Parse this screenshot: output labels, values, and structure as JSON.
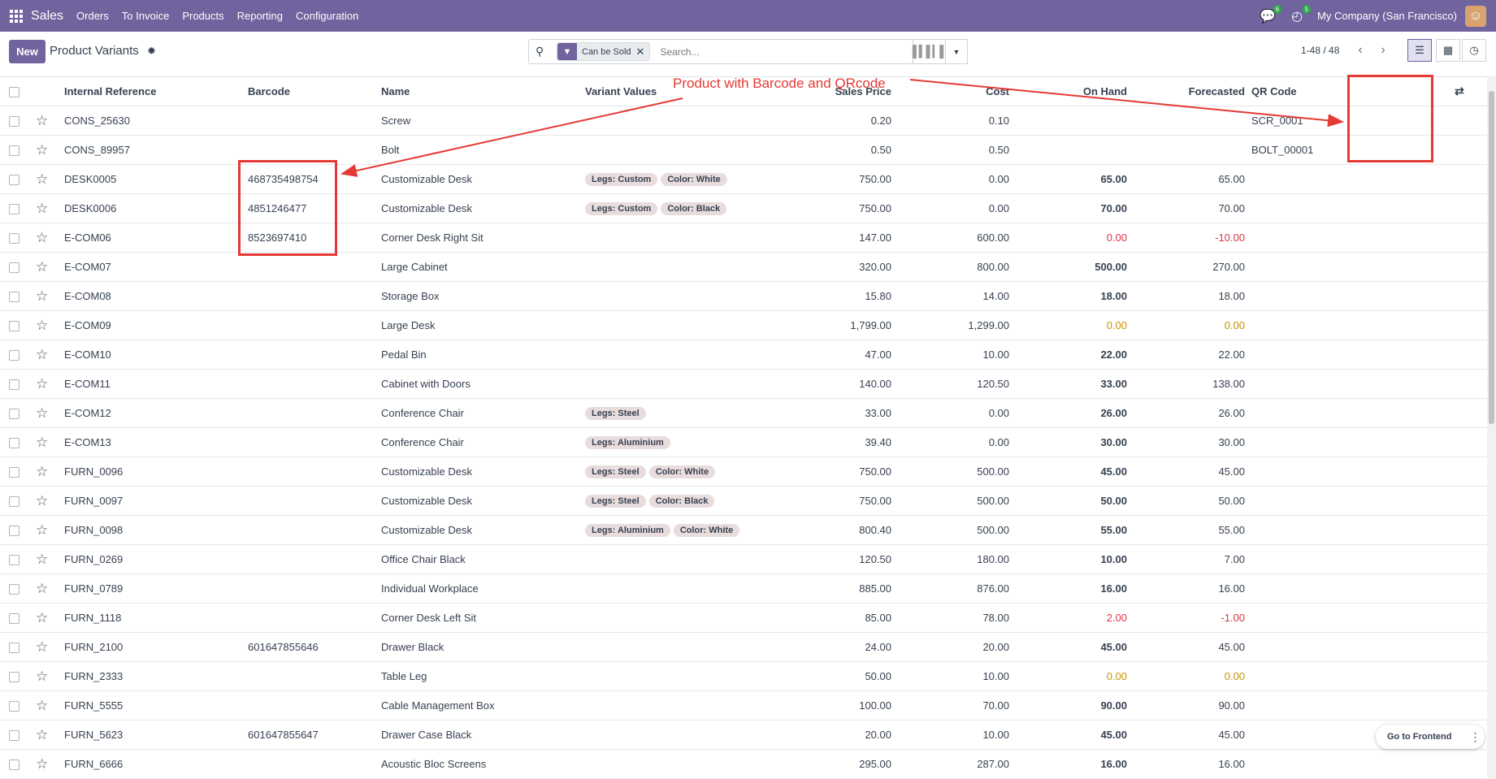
{
  "navbar": {
    "app_name": "Sales",
    "menu": [
      "Orders",
      "To Invoice",
      "Products",
      "Reporting",
      "Configuration"
    ],
    "messages_count": "6",
    "activities_count": "5",
    "company": "My Company (San Francisco)"
  },
  "control": {
    "new_label": "New",
    "title": "Product Variants",
    "facet": "Can be Sold",
    "search_placeholder": "Search...",
    "pager": "1-48 / 48"
  },
  "columns": [
    "Internal Reference",
    "Barcode",
    "Name",
    "Variant Values",
    "Sales Price",
    "Cost",
    "On Hand",
    "Forecasted",
    "QR Code"
  ],
  "rows": [
    {
      "ref": "CONS_25630",
      "barcode": "",
      "name": "Screw",
      "tags": [],
      "price": "0.20",
      "cost": "0.10",
      "onhand": "",
      "forecast": "",
      "qr": "SCR_0001",
      "status": "none"
    },
    {
      "ref": "CONS_89957",
      "barcode": "",
      "name": "Bolt",
      "tags": [],
      "price": "0.50",
      "cost": "0.50",
      "onhand": "",
      "forecast": "",
      "qr": "BOLT_00001",
      "status": "none"
    },
    {
      "ref": "DESK0005",
      "barcode": "468735498754",
      "name": "Customizable Desk",
      "tags": [
        "Legs: Custom",
        "Color: White"
      ],
      "price": "750.00",
      "cost": "0.00",
      "onhand": "65.00",
      "forecast": "65.00",
      "qr": "",
      "status": "normal"
    },
    {
      "ref": "DESK0006",
      "barcode": "4851246477",
      "name": "Customizable Desk",
      "tags": [
        "Legs: Custom",
        "Color: Black"
      ],
      "price": "750.00",
      "cost": "0.00",
      "onhand": "70.00",
      "forecast": "70.00",
      "qr": "",
      "status": "normal"
    },
    {
      "ref": "E-COM06",
      "barcode": "8523697410",
      "name": "Corner Desk Right Sit",
      "tags": [],
      "price": "147.00",
      "cost": "600.00",
      "onhand": "0.00",
      "forecast": "-10.00",
      "qr": "",
      "status": "negative"
    },
    {
      "ref": "E-COM07",
      "barcode": "",
      "name": "Large Cabinet",
      "tags": [],
      "price": "320.00",
      "cost": "800.00",
      "onhand": "500.00",
      "forecast": "270.00",
      "qr": "",
      "status": "normal"
    },
    {
      "ref": "E-COM08",
      "barcode": "",
      "name": "Storage Box",
      "tags": [],
      "price": "15.80",
      "cost": "14.00",
      "onhand": "18.00",
      "forecast": "18.00",
      "qr": "",
      "status": "normal"
    },
    {
      "ref": "E-COM09",
      "barcode": "",
      "name": "Large Desk",
      "tags": [],
      "price": "1,799.00",
      "cost": "1,299.00",
      "onhand": "0.00",
      "forecast": "0.00",
      "qr": "",
      "status": "zero"
    },
    {
      "ref": "E-COM10",
      "barcode": "",
      "name": "Pedal Bin",
      "tags": [],
      "price": "47.00",
      "cost": "10.00",
      "onhand": "22.00",
      "forecast": "22.00",
      "qr": "",
      "status": "normal"
    },
    {
      "ref": "E-COM11",
      "barcode": "",
      "name": "Cabinet with Doors",
      "tags": [],
      "price": "140.00",
      "cost": "120.50",
      "onhand": "33.00",
      "forecast": "138.00",
      "qr": "",
      "status": "normal"
    },
    {
      "ref": "E-COM12",
      "barcode": "",
      "name": "Conference Chair",
      "tags": [
        "Legs: Steel"
      ],
      "price": "33.00",
      "cost": "0.00",
      "onhand": "26.00",
      "forecast": "26.00",
      "qr": "",
      "status": "normal"
    },
    {
      "ref": "E-COM13",
      "barcode": "",
      "name": "Conference Chair",
      "tags": [
        "Legs: Aluminium"
      ],
      "price": "39.40",
      "cost": "0.00",
      "onhand": "30.00",
      "forecast": "30.00",
      "qr": "",
      "status": "normal"
    },
    {
      "ref": "FURN_0096",
      "barcode": "",
      "name": "Customizable Desk",
      "tags": [
        "Legs: Steel",
        "Color: White"
      ],
      "price": "750.00",
      "cost": "500.00",
      "onhand": "45.00",
      "forecast": "45.00",
      "qr": "",
      "status": "normal"
    },
    {
      "ref": "FURN_0097",
      "barcode": "",
      "name": "Customizable Desk",
      "tags": [
        "Legs: Steel",
        "Color: Black"
      ],
      "price": "750.00",
      "cost": "500.00",
      "onhand": "50.00",
      "forecast": "50.00",
      "qr": "",
      "status": "normal"
    },
    {
      "ref": "FURN_0098",
      "barcode": "",
      "name": "Customizable Desk",
      "tags": [
        "Legs: Aluminium",
        "Color: White"
      ],
      "price": "800.40",
      "cost": "500.00",
      "onhand": "55.00",
      "forecast": "55.00",
      "qr": "",
      "status": "normal"
    },
    {
      "ref": "FURN_0269",
      "barcode": "",
      "name": "Office Chair Black",
      "tags": [],
      "price": "120.50",
      "cost": "180.00",
      "onhand": "10.00",
      "forecast": "7.00",
      "qr": "",
      "status": "normal"
    },
    {
      "ref": "FURN_0789",
      "barcode": "",
      "name": "Individual Workplace",
      "tags": [],
      "price": "885.00",
      "cost": "876.00",
      "onhand": "16.00",
      "forecast": "16.00",
      "qr": "",
      "status": "normal"
    },
    {
      "ref": "FURN_1118",
      "barcode": "",
      "name": "Corner Desk Left Sit",
      "tags": [],
      "price": "85.00",
      "cost": "78.00",
      "onhand": "2.00",
      "forecast": "-1.00",
      "qr": "",
      "status": "negative"
    },
    {
      "ref": "FURN_2100",
      "barcode": "601647855646",
      "name": "Drawer Black",
      "tags": [],
      "price": "24.00",
      "cost": "20.00",
      "onhand": "45.00",
      "forecast": "45.00",
      "qr": "",
      "status": "normal"
    },
    {
      "ref": "FURN_2333",
      "barcode": "",
      "name": "Table Leg",
      "tags": [],
      "price": "50.00",
      "cost": "10.00",
      "onhand": "0.00",
      "forecast": "0.00",
      "qr": "",
      "status": "zero"
    },
    {
      "ref": "FURN_5555",
      "barcode": "",
      "name": "Cable Management Box",
      "tags": [],
      "price": "100.00",
      "cost": "70.00",
      "onhand": "90.00",
      "forecast": "90.00",
      "qr": "",
      "status": "normal"
    },
    {
      "ref": "FURN_5623",
      "barcode": "601647855647",
      "name": "Drawer Case Black",
      "tags": [],
      "price": "20.00",
      "cost": "10.00",
      "onhand": "45.00",
      "forecast": "45.00",
      "qr": "",
      "status": "normal"
    },
    {
      "ref": "FURN_6666",
      "barcode": "",
      "name": "Acoustic Bloc Screens",
      "tags": [],
      "price": "295.00",
      "cost": "287.00",
      "onhand": "16.00",
      "forecast": "16.00",
      "qr": "",
      "status": "normal"
    }
  ],
  "annotation": "Product with Barcode and QRcode",
  "frontend_label": "Go to Frontend",
  "colors": {
    "brand": "#71639e",
    "annotation": "#e53935",
    "negative": "#dc3545",
    "zero": "#c79100"
  }
}
